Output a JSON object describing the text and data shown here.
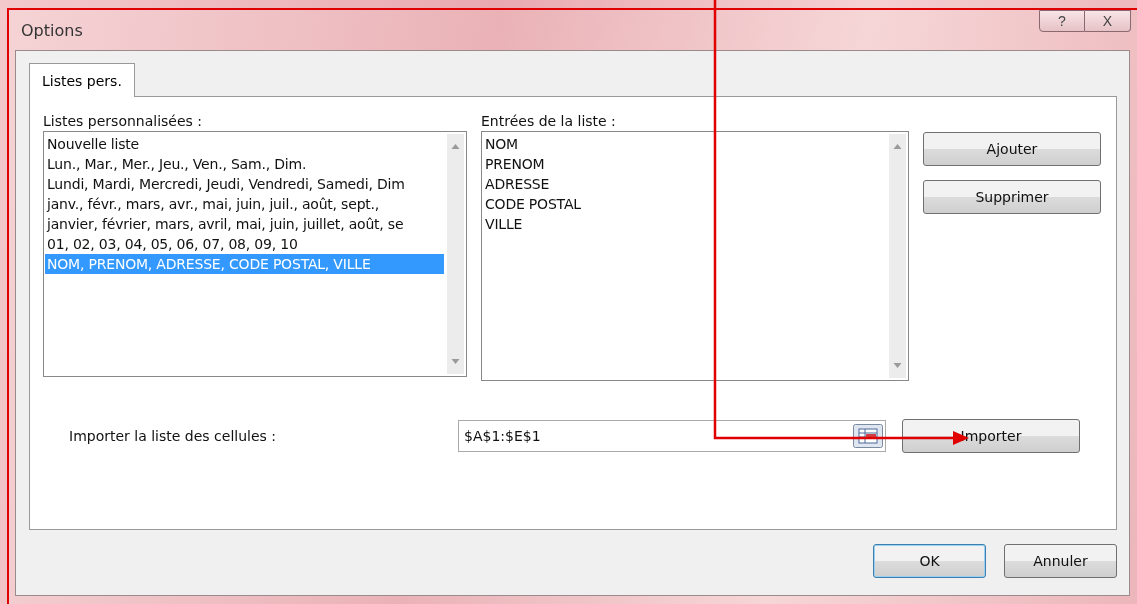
{
  "window": {
    "title": "Options",
    "help": "?",
    "close": "X"
  },
  "tabs": [
    {
      "label": "Listes pers.",
      "selected": true
    }
  ],
  "custom_lists": {
    "label": "Listes personnalisées :",
    "items": [
      {
        "text": "Nouvelle liste",
        "selected": false
      },
      {
        "text": "Lun., Mar., Mer., Jeu., Ven., Sam., Dim.",
        "selected": false
      },
      {
        "text": "Lundi, Mardi, Mercredi, Jeudi, Vendredi, Samedi, Dim",
        "selected": false
      },
      {
        "text": "janv., févr., mars, avr., mai, juin, juil., août, sept.,",
        "selected": false
      },
      {
        "text": "janvier, février, mars, avril, mai, juin, juillet, août, se",
        "selected": false
      },
      {
        "text": "01, 02, 03, 04, 05, 06, 07, 08, 09, 10",
        "selected": false
      },
      {
        "text": "NOM, PRENOM, ADRESSE, CODE POSTAL, VILLE",
        "selected": true
      }
    ]
  },
  "entries": {
    "label": "Entrées de la liste :",
    "lines": [
      "NOM",
      "PRENOM",
      "ADRESSE",
      "CODE POSTAL",
      "VILLE"
    ]
  },
  "side_buttons": [
    "Ajouter",
    "Supprimer"
  ],
  "import": {
    "label": "Importer la liste des cellules :",
    "value": "$A$1:$E$1",
    "button": "Importer"
  },
  "footer_buttons": [
    {
      "label": "OK",
      "default": true
    },
    {
      "label": "Annuler",
      "default": false
    }
  ]
}
